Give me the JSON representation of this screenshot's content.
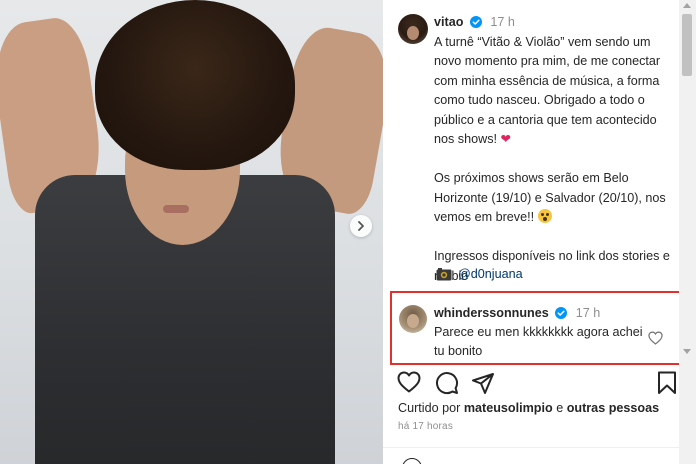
{
  "post": {
    "image_alt": "Photo of a person with curly hair wearing a dark sleeveless shirt",
    "author": {
      "username": "vitao",
      "time": "17 h"
    },
    "caption": {
      "p1": "A turnê “Vitão & Violão” vem sendo um novo momento pra mim, de me conectar com minha essência de música, a forma como tudo nasceu. Obrigado a todo o público e a cantoria que tem acontecido nos shows!",
      "p2": "Os próximos shows serão em Belo Horizonte (19/10) e Salvador (20/10), nos vemos em breve!!",
      "p3": "Ingressos disponíveis no link dos stories e na bio"
    },
    "credit": {
      "handle": "@d0njuana"
    }
  },
  "comment": {
    "username": "whinderssonnunes",
    "time": "17 h",
    "text": "Parece eu men kkkkkkkk agora achei tu bonito",
    "highlight_color": "#e0312f"
  },
  "actions": {
    "like_icon": "heart-icon",
    "comment_icon": "comment-icon",
    "share_icon": "share-icon",
    "save_icon": "bookmark-icon"
  },
  "likes": {
    "prefix": "Curtido por",
    "user": "mateusolimpio",
    "connector": "e",
    "others": "outras pessoas"
  },
  "timestamp": "há 17 horas",
  "colors": {
    "verified": "#0095f6",
    "heart": "#e0245e",
    "link": "#00376b"
  }
}
